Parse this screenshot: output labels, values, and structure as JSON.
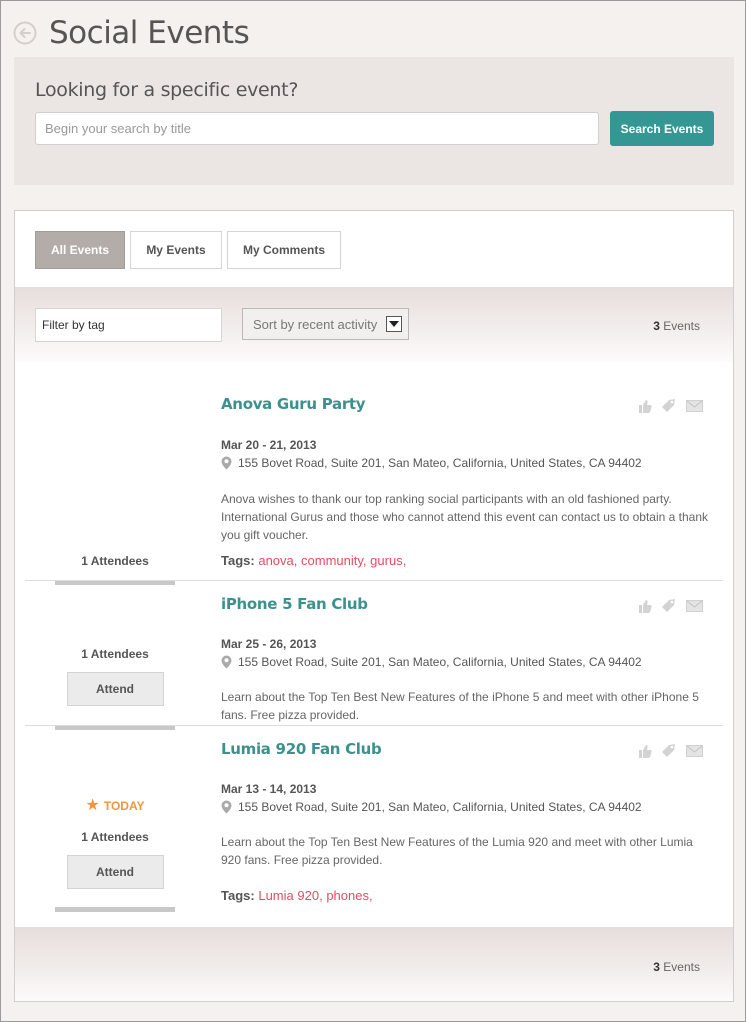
{
  "header": {
    "title": "Social Events"
  },
  "search": {
    "heading": "Looking for a specific event?",
    "placeholder": "Begin your search by title",
    "button_label": "Search Events"
  },
  "tabs": [
    {
      "label": "All Events",
      "active": true
    },
    {
      "label": "My Events",
      "active": false
    },
    {
      "label": "My Comments",
      "active": false
    }
  ],
  "filters": {
    "tag_placeholder": "Filter by tag",
    "sort_value": "Sort by recent activity"
  },
  "count": {
    "number": "3",
    "label": " Events"
  },
  "events": [
    {
      "title": "Anova Guru Party",
      "date": "Mar 20 - 21, 2013",
      "address": "155 Bovet Road, Suite 201, San Mateo, California, United States, CA 94402",
      "description": "Anova wishes to thank our top ranking social participants with an old fashioned party. International Gurus and those who cannot attend this event can contact us to obtain a thank you gift voucher.",
      "tags_label": "Tags:",
      "tags": [
        "anova",
        "community",
        "gurus"
      ],
      "attendees": "1 Attendees",
      "attend_label": "",
      "today_label": ""
    },
    {
      "title": "iPhone 5 Fan Club",
      "date": "Mar 25 - 26, 2013",
      "address": "155 Bovet Road, Suite 201, San Mateo, California, United States, CA 94402",
      "description": "Learn about the Top Ten Best New Features of the iPhone 5 and meet with other iPhone 5 fans. Free pizza provided.",
      "tags_label": "",
      "tags": [],
      "attendees": "1 Attendees",
      "attend_label": "Attend",
      "today_label": ""
    },
    {
      "title": "Lumia 920 Fan Club",
      "date": "Mar 13 - 14, 2013",
      "address": "155 Bovet Road, Suite 201, San Mateo, California, United States, CA 94402",
      "description": "Learn about the Top Ten Best New Features of the Lumia 920 and meet with other Lumia 920 fans. Free pizza provided.",
      "tags_label": "Tags:",
      "tags": [
        "Lumia 920",
        "phones"
      ],
      "attendees": "1 Attendees",
      "attend_label": "Attend",
      "today_label": "TODAY"
    }
  ],
  "icons": {
    "back": "back-arrow-icon",
    "like": "thumbs-up-icon",
    "tag": "tag-icon",
    "mail": "envelope-icon",
    "pin": "map-pin-icon",
    "star": "star-icon"
  },
  "colors": {
    "accent": "#359793",
    "title": "#3c918d",
    "tag": "#e34d5f",
    "today": "#f0963c",
    "active_tab": "#b4aca8"
  }
}
